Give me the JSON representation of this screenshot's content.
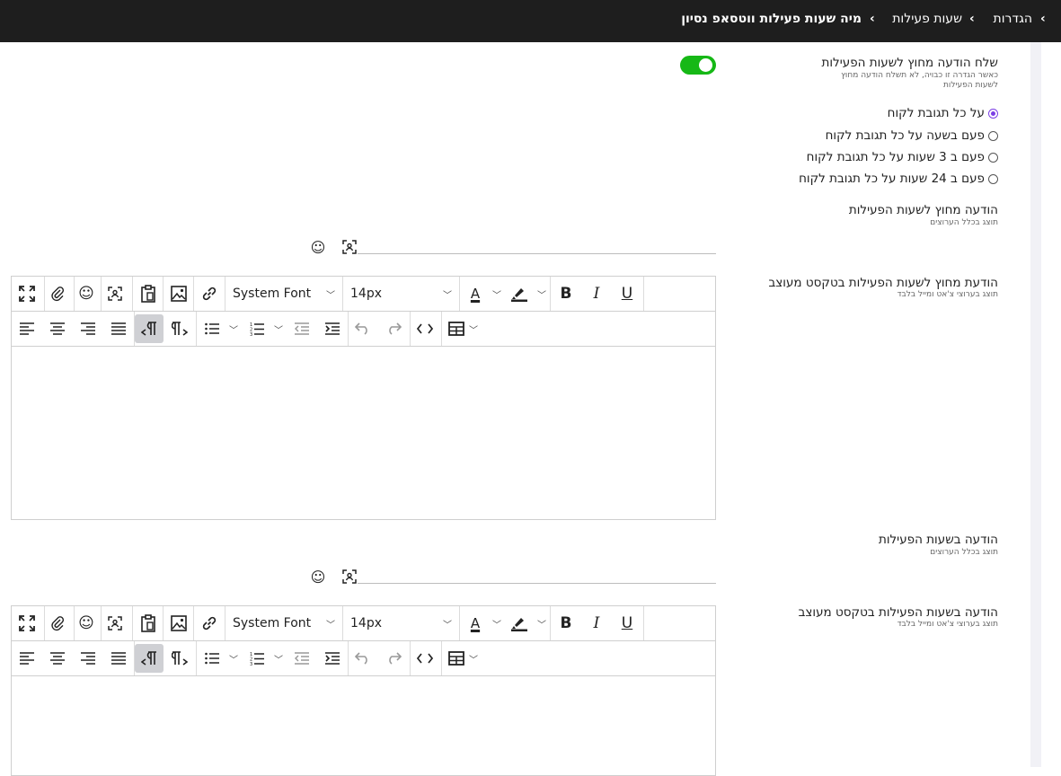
{
  "breadcrumb": {
    "items": [
      "הגדרות",
      "שעות פעילות",
      "מיה שעות פעילות ווטסאפ נסיון"
    ]
  },
  "colors": {
    "topbar": "#1e1e1e",
    "toggle_on": "#16b816",
    "radio_accent": "#7b3fe4"
  },
  "off_hours": {
    "toggle_label": "שלח הודעה מחוץ לשעות הפעילות",
    "toggle_desc_line1": "כאשר הגדרה זו כבויה, לא תשלח הודעה מחוץ",
    "toggle_desc_line2": "לשעות הפעילות",
    "toggle_on": true,
    "frequency_options": [
      {
        "label": "על כל תגובת לקוח",
        "checked": true
      },
      {
        "label": "פעם בשעה על כל תגובת לקוח",
        "checked": false
      },
      {
        "label": "פעם ב 3 שעות על כל תגובת לקוח",
        "checked": false
      },
      {
        "label": "פעם ב 24 שעות על כל תגובת לקוח",
        "checked": false
      }
    ],
    "message_label": "הודעה מחוץ לשעות הפעילות",
    "message_sub": "תוצג בכלל הערוצים",
    "rich_label": "הודעת מחוץ לשעות הפעילות בטקסט מעוצב",
    "rich_sub": "תוצג בערוצי צ'אט ומייל בלבד"
  },
  "in_hours": {
    "message_label": "הודעה בשעות הפעילות",
    "message_sub": "תוצג בכלל הערוצים",
    "rich_label": "הודעה בשעות הפעילות בטקסט מעוצב",
    "rich_sub": "תוצג בערוצי צ'אט ומייל בלבד"
  },
  "editor": {
    "font_value": "System Font",
    "size_value": "14px",
    "bold": "B",
    "italic": "I",
    "underline": "U",
    "text_color": "A"
  }
}
